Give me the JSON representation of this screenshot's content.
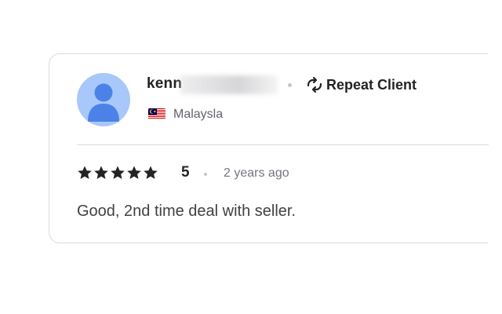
{
  "review": {
    "username": "kenn",
    "username_obscured": true,
    "badge": {
      "icon": "repeat-icon",
      "label": "Repeat Client"
    },
    "country": {
      "flag_icon": "malaysia-flag-icon",
      "name": "Malaysla"
    },
    "rating": {
      "stars": 5,
      "max": 5,
      "value": "5",
      "star_color": "#222325"
    },
    "time_ago": "2 years ago",
    "text": "Good, 2nd time deal with seller.",
    "avatar": {
      "icon": "default-user-avatar-icon",
      "bg_color": "#a8c7fa",
      "fg_color": "#4c82e8"
    }
  }
}
